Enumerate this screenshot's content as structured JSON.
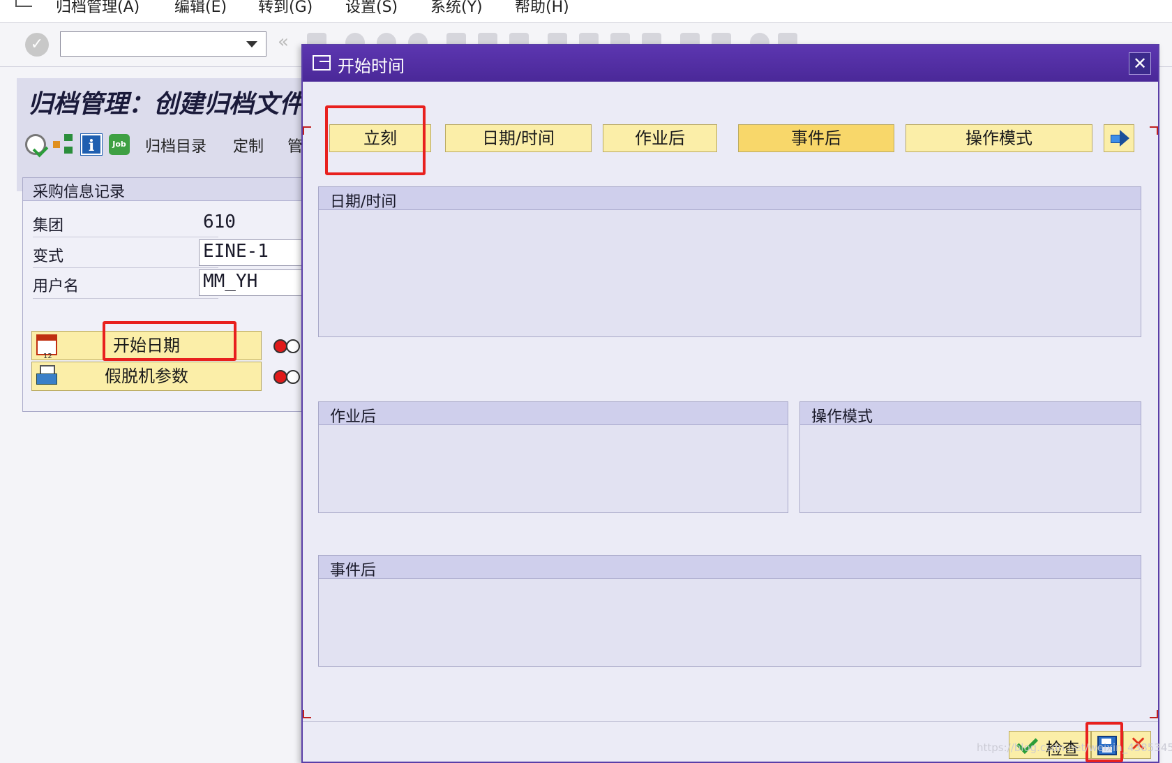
{
  "menubar": {
    "items": [
      "归档管理(A)",
      "编辑(E)",
      "转到(G)",
      "设置(S)",
      "系统(Y)",
      "帮助(H)"
    ]
  },
  "toolbar": {
    "command_field": {
      "value": "",
      "placeholder": ""
    }
  },
  "page": {
    "title": "归档管理：创建归档文件",
    "app_toolbar": [
      "归档目录",
      "定制",
      "管"
    ],
    "group": {
      "title": "采购信息记录",
      "fields": [
        {
          "label": "集团",
          "value": "610"
        },
        {
          "label": "变式",
          "value": "EINE-1"
        },
        {
          "label": "用户名",
          "value": "MM_YH"
        }
      ]
    },
    "buttons": {
      "start_date": "开始日期",
      "spool_params": "假脱机参数"
    }
  },
  "dialog": {
    "title": "开始时间",
    "close": "✕",
    "tabs": [
      "立刻",
      "日期/时间",
      "作业后",
      "事件后",
      "操作模式"
    ],
    "active_tab_index": 3,
    "sections": {
      "datetime": "日期/时间",
      "after_job": "作业后",
      "op_mode": "操作模式",
      "after_event": "事件后"
    },
    "footer": {
      "check": "检查"
    }
  },
  "colors": {
    "title_bar": "#4a2898",
    "button_yellow": "#fbeea8",
    "highlight_red": "#e8201e"
  },
  "watermark": "https://blog.csdn.net/weixin_4385345"
}
